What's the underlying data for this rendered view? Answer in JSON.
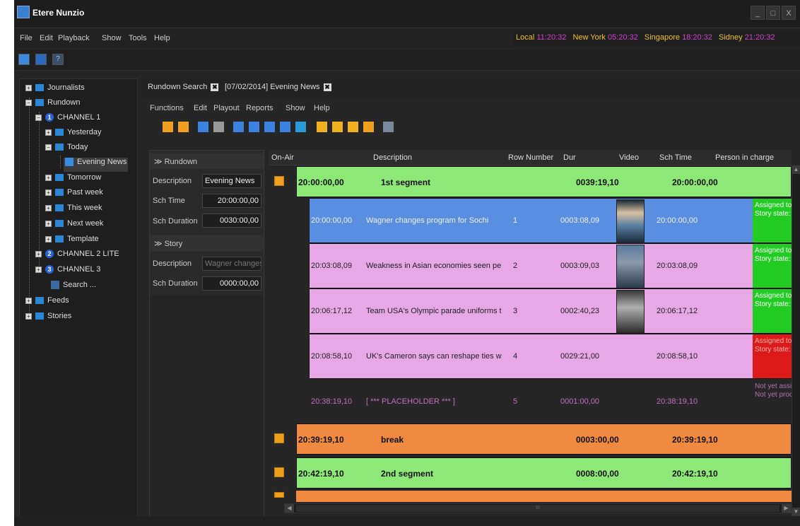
{
  "window": {
    "title": "Etere Nunzio",
    "minimize": "_",
    "maximize": "□",
    "close": "X"
  },
  "menu": [
    "File",
    "Edit",
    "Playback",
    "Show",
    "Tools",
    "Help"
  ],
  "clocks": [
    {
      "city": "Local",
      "time": "11:20:32"
    },
    {
      "city": "New York",
      "time": "05:20:32"
    },
    {
      "city": "Singapore",
      "time": "18:20:32"
    },
    {
      "city": "Sidney",
      "time": "21:20:32"
    }
  ],
  "toolbar_icons": [
    "refresh-icon",
    "window-icon",
    "help-pointer-icon"
  ],
  "tree": {
    "journalists": "Journalists",
    "rundown": "Rundown",
    "channel1": {
      "num": "1",
      "label": "CHANNEL 1"
    },
    "yesterday": "Yesterday",
    "today": "Today",
    "evening_news": "Evening News",
    "tomorrow": "Tomorrow",
    "past_week": "Past week",
    "this_week": "This week",
    "next_week": "Next week",
    "template": "Template",
    "channel2": {
      "num": "2",
      "label": "CHANNEL 2 LITE"
    },
    "channel3": {
      "num": "3",
      "label": "CHANNEL 3"
    },
    "search": "Search ...",
    "feeds": "Feeds",
    "stories": "Stories"
  },
  "tabs": [
    {
      "label": "Rundown Search",
      "close": "✖"
    },
    {
      "label": "[07/02/2014] Evening News",
      "close": "✖"
    }
  ],
  "sub_menu": [
    "Functions",
    "Edit",
    "Playout",
    "Reports",
    "Show",
    "Help"
  ],
  "sub_toolbar_colors": [
    "#f0a020",
    "#f0a020",
    "#3c82e0",
    "#999999",
    "#3c82e0",
    "#3c82e0",
    "#3c82e0",
    "#3c82e0",
    "#2a9ad8",
    "#f0b020",
    "#f0b020",
    "#f0b020",
    "#f0a020",
    "#7a8a9a"
  ],
  "props": {
    "rundown_header": "≫ Rundown",
    "description_label": "Description",
    "description_value": "Evening News",
    "sch_time_label": "Sch Time",
    "sch_time_value": "20:00:00,00",
    "sch_duration_label": "Sch Duration",
    "sch_duration_value": "0030:00,00",
    "story_header": "≫ Story",
    "story_description_label": "Description",
    "story_description_value": "Wagner changes",
    "story_duration_label": "Sch Duration",
    "story_duration_value": "0000:00,00"
  },
  "grid": {
    "columns": {
      "on_air": "On-Air",
      "description": "Description",
      "row_number": "Row Number",
      "dur": "Dur",
      "video": "Video",
      "sch_time": "Sch Time",
      "person": "Person in charge"
    },
    "segments": [
      {
        "time": "20:00:00,00",
        "desc": "1st segment",
        "dur": "0039:19,10",
        "sch": "20:00:00,00",
        "color": "#8ee878"
      },
      {
        "time": "20:39:19,10",
        "desc": "break",
        "dur": "0003:00,00",
        "sch": "20:39:19,10",
        "color": "#f08a40"
      },
      {
        "time": "20:42:19,10",
        "desc": "2nd segment",
        "dur": "0008:00,00",
        "sch": "20:42:19,10",
        "color": "#8ee878"
      }
    ],
    "stories": [
      {
        "time": "20:00:00,00",
        "desc": "Wagner changes program for Sochi",
        "row": "1",
        "dur": "0003:08,09",
        "sch": "20:00:00,00",
        "person1": "Assigned to: Vasqu",
        "person2": "Story state: Ready",
        "color": "#5a8ee0",
        "person_color": "#22cc22"
      },
      {
        "time": "20:03:08,09",
        "desc": "Weakness in Asian economies seen persis",
        "row": "2",
        "dur": "0003:09,03",
        "sch": "20:03:08,09",
        "person1": "Assigned to: Vasqu",
        "person2": "Story state: Ready",
        "color": "#e8a8e8",
        "person_color": "#22cc22"
      },
      {
        "time": "20:06:17,12",
        "desc": "Team USA's Olympic parade uniforms torr",
        "row": "3",
        "dur": "0002:40,23",
        "sch": "20:06:17,12",
        "person1": "Assigned to: Vasqu",
        "person2": "Story state: Ready",
        "color": "#e8a8e8",
        "person_color": "#22cc22"
      },
      {
        "time": "20:08:58,10",
        "desc": "UK's Cameron says can reshape ties with",
        "row": "4",
        "dur": "0029:21,00",
        "sch": "20:08:58,10",
        "person1": "Assigned to: Vasq",
        "person2": "Story state: Not r",
        "color": "#e8a8e8",
        "person_color": "#dd1a1a"
      },
      {
        "time": "20:38:19,10",
        "desc": "[ *** PLACEHOLDER *** ]",
        "row": "5",
        "dur": "0001:00,00",
        "sch": "20:38:19,10",
        "person1": "Not yet assigned",
        "person2": "Not yet processed",
        "color": "#262626",
        "person_color": "#262626"
      }
    ],
    "hscroll_thumb": "III"
  }
}
